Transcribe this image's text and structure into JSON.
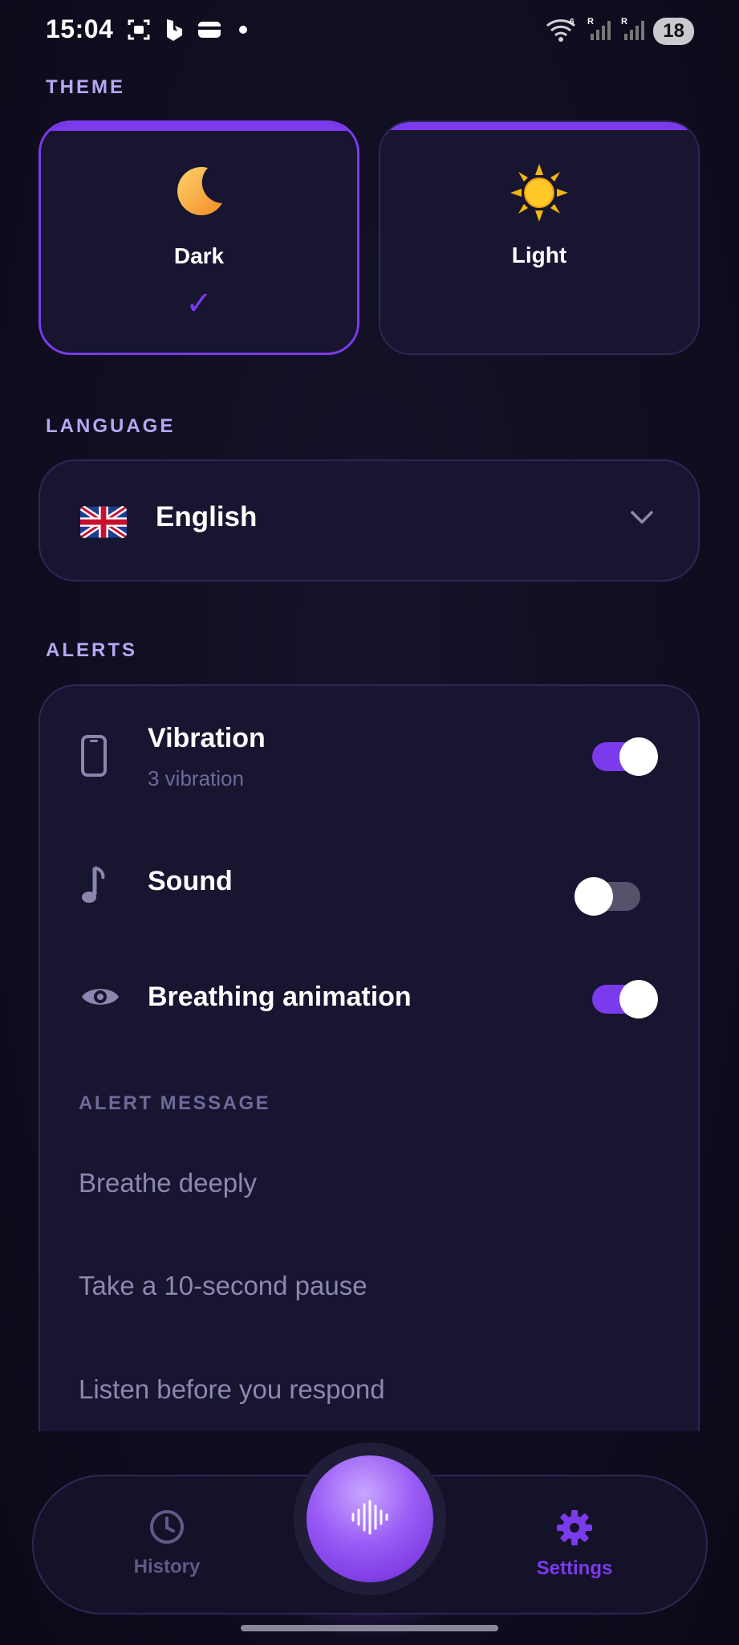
{
  "status_bar": {
    "time": "15:04",
    "battery": "18"
  },
  "sections": {
    "theme": "THEME",
    "language": "LANGUAGE",
    "alerts": "ALERTS"
  },
  "theme": {
    "options": [
      {
        "label": "Dark",
        "icon": "moon-icon",
        "selected": true,
        "check": "✓"
      },
      {
        "label": "Light",
        "icon": "sun-icon",
        "selected": false
      }
    ]
  },
  "language": {
    "selected": "English",
    "flag": "uk-flag-icon"
  },
  "alerts": {
    "vibration": {
      "title": "Vibration",
      "subtitle": "3 vibration",
      "enabled": true
    },
    "sound": {
      "title": "Sound",
      "enabled": false
    },
    "breathing": {
      "title": "Breathing animation",
      "enabled": true
    },
    "message_label": "ALERT MESSAGE",
    "messages": [
      "Breathe deeply",
      "Take a 10-second pause",
      "Listen before you respond"
    ]
  },
  "nav": {
    "history": "History",
    "settings": "Settings",
    "active": "settings"
  },
  "colors": {
    "accent": "#7c3aed",
    "section_label": "#b8a6f2",
    "card": "#171530"
  }
}
